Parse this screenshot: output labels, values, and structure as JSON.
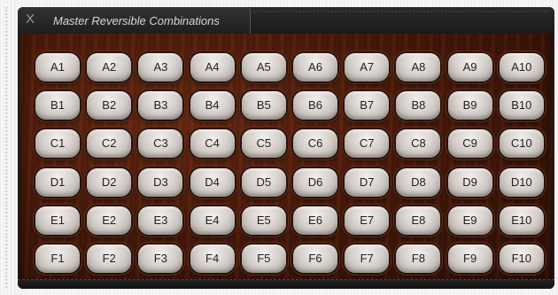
{
  "window": {
    "title": "Master Reversible Combinations",
    "close_icon": "X"
  },
  "rows": [
    [
      "A1",
      "A2",
      "A3",
      "A4",
      "A5",
      "A6",
      "A7",
      "A8",
      "A9",
      "A10"
    ],
    [
      "B1",
      "B2",
      "B3",
      "B4",
      "B5",
      "B6",
      "B7",
      "B8",
      "B9",
      "B10"
    ],
    [
      "C1",
      "C2",
      "C3",
      "C4",
      "C5",
      "C6",
      "C7",
      "C8",
      "C9",
      "C10"
    ],
    [
      "D1",
      "D2",
      "D3",
      "D4",
      "D5",
      "D6",
      "D7",
      "D8",
      "D9",
      "D10"
    ],
    [
      "E1",
      "E2",
      "E3",
      "E4",
      "E5",
      "E6",
      "E7",
      "E8",
      "E9",
      "E10"
    ],
    [
      "F1",
      "F2",
      "F3",
      "F4",
      "F5",
      "F6",
      "F7",
      "F8",
      "F9",
      "F10"
    ]
  ]
}
